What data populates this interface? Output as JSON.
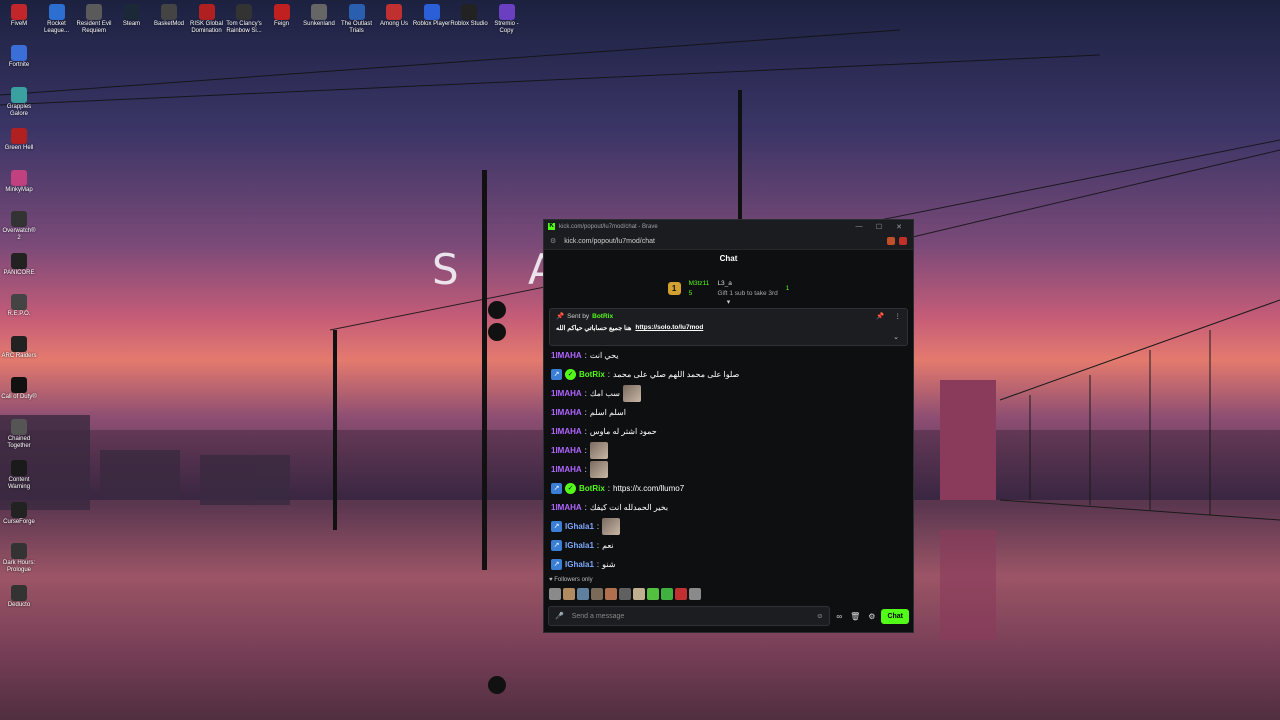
{
  "desktop": {
    "top_icons": [
      {
        "label": "FiveM",
        "color": "#c0262a"
      },
      {
        "label": "Rocket League...",
        "color": "#2c6fd1"
      },
      {
        "label": "Resident Evil Requiem",
        "color": "#5a5a5a"
      },
      {
        "label": "Steam",
        "color": "#1b2838"
      },
      {
        "label": "BasketMod",
        "color": "#444"
      },
      {
        "label": "RISK Global Domination",
        "color": "#b02020"
      },
      {
        "label": "Tom Clancy's Rainbow Si...",
        "color": "#333"
      },
      {
        "label": "Feign",
        "color": "#c02020"
      },
      {
        "label": "Sunkenland",
        "color": "#666"
      },
      {
        "label": "The Outlast Trials",
        "color": "#2a5fb0"
      },
      {
        "label": "Among Us",
        "color": "#c03030"
      },
      {
        "label": "Roblox Player",
        "color": "#2b5fd8"
      },
      {
        "label": "Roblox Studio",
        "color": "#222"
      },
      {
        "label": "Stremio - Copy",
        "color": "#6a3fc0"
      }
    ],
    "left_icons": [
      {
        "label": "Fortnite",
        "color": "#3a6fd8"
      },
      {
        "label": "Grapples Galore",
        "color": "#3aa0a0"
      },
      {
        "label": "Green Hell",
        "color": "#b02020"
      },
      {
        "label": "MinkyMap",
        "color": "#c04080"
      },
      {
        "label": "Overwatch® 2",
        "color": "#333"
      },
      {
        "label": "PANICORE",
        "color": "#222"
      },
      {
        "label": "R.E.P.O.",
        "color": "#444"
      },
      {
        "label": "ARC Raiders",
        "color": "#222"
      },
      {
        "label": "Call of Duty®",
        "color": "#111"
      },
      {
        "label": "Chained Together",
        "color": "#555"
      },
      {
        "label": "Content Warning",
        "color": "#1a1a1a"
      },
      {
        "label": "CurseForge",
        "color": "#222"
      },
      {
        "label": "Dark Hours: Prologue",
        "color": "#333"
      },
      {
        "label": "Deducto",
        "color": "#333"
      }
    ],
    "wallpaper_logo": "S A"
  },
  "browser": {
    "tab_title": "kick.com/popout/lu7mod/chat - Brave",
    "url": "kick.com/popout/lu7mod/chat"
  },
  "chat": {
    "header": "Chat",
    "leaderboard": {
      "rank": "1",
      "top_user": "M3tz11",
      "top_count": "5",
      "second_user": "L3_a",
      "second_count": "1",
      "gift_text": "Gift 1 sub to take 3rd"
    },
    "pinned": {
      "sent_by_label": "Sent by",
      "sender": "BotRix",
      "text": "هنا جميع حساباتي حياكم الله",
      "link": "https://solo.to/lu7mod"
    },
    "messages": [
      {
        "user": "1IMAHA",
        "color": "#b066ff",
        "text": "يحي انت",
        "badges": false,
        "verified": false,
        "emote": false,
        "link": false
      },
      {
        "user": "BotRix",
        "color": "#53fc18",
        "text": "صلوا على محمد اللهم صلي على محمد",
        "badges": true,
        "verified": true,
        "emote": false,
        "link": false
      },
      {
        "user": "1IMAHA",
        "color": "#b066ff",
        "text": "سب امك",
        "badges": false,
        "verified": false,
        "emote": true,
        "link": false
      },
      {
        "user": "1IMAHA",
        "color": "#b066ff",
        "text": "اسلم اسلم",
        "badges": false,
        "verified": false,
        "emote": false,
        "link": false
      },
      {
        "user": "1IMAHA",
        "color": "#b066ff",
        "text": "حمود اشتر له ماوس",
        "badges": false,
        "verified": false,
        "emote": false,
        "link": false
      },
      {
        "user": "1IMAHA",
        "color": "#b066ff",
        "text": "",
        "badges": false,
        "verified": false,
        "emote": true,
        "link": false
      },
      {
        "user": "1IMAHA",
        "color": "#b066ff",
        "text": "",
        "badges": false,
        "verified": false,
        "emote": true,
        "link": false
      },
      {
        "user": "BotRix",
        "color": "#53fc18",
        "text": "https://x.com/llumo7",
        "badges": true,
        "verified": true,
        "emote": false,
        "link": true
      },
      {
        "user": "1IMAHA",
        "color": "#b066ff",
        "text": "بخير الحمدلله انت كيفك",
        "badges": false,
        "verified": false,
        "emote": false,
        "link": false
      },
      {
        "user": "IGhala1",
        "color": "#7fa8ff",
        "text": "",
        "badges": true,
        "verified": false,
        "emote": true,
        "link": false
      },
      {
        "user": "IGhala1",
        "color": "#7fa8ff",
        "text": "نعم",
        "badges": true,
        "verified": false,
        "emote": false,
        "link": false
      },
      {
        "user": "IGhala1",
        "color": "#7fa8ff",
        "text": "شنو",
        "badges": true,
        "verified": false,
        "emote": false,
        "link": false
      }
    ],
    "followers_only": "Followers only",
    "emote_bar": [
      "#8a8a8a",
      "#b08a60",
      "#6080a0",
      "#7a6a5a",
      "#b07050",
      "#606060",
      "#c0b090",
      "#53c040",
      "#40b040",
      "#c03030",
      "#8a8a8a"
    ],
    "input_placeholder": "Send a message",
    "send_label": "Chat"
  }
}
